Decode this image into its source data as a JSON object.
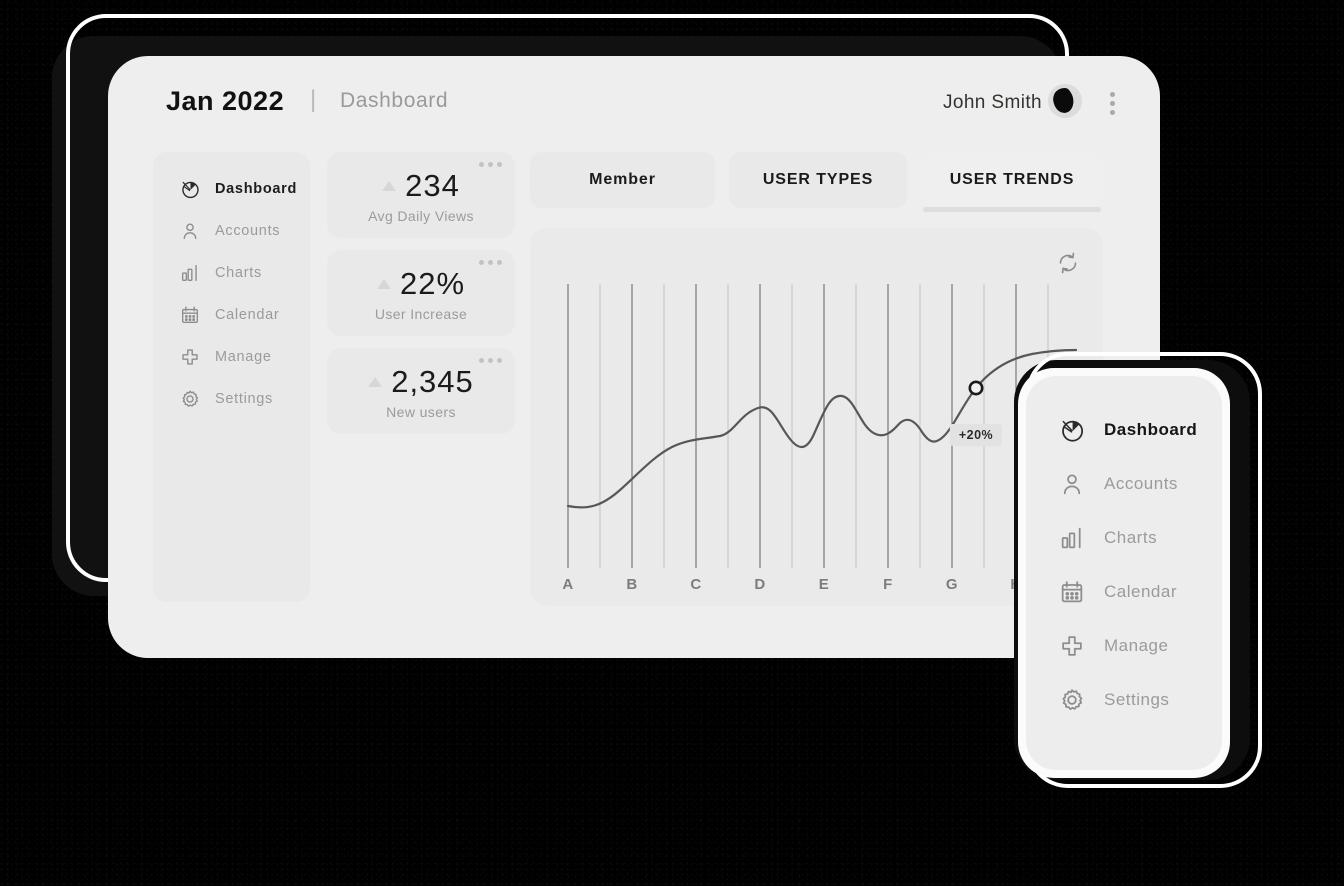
{
  "header": {
    "date_title": "Jan 2022",
    "separator": "|",
    "breadcrumb": "Dashboard",
    "user_name": "John Smith",
    "avatar_icon": "user-avatar",
    "menu_icon": "kebab-vertical-icon"
  },
  "sidebar": {
    "items": [
      {
        "label": "Dashboard",
        "icon": "pie-chart-icon",
        "active": true
      },
      {
        "label": "Accounts",
        "icon": "user-icon",
        "active": false
      },
      {
        "label": "Charts",
        "icon": "bar-chart-icon",
        "active": false
      },
      {
        "label": "Calendar",
        "icon": "calendar-icon",
        "active": false
      },
      {
        "label": "Manage",
        "icon": "plus-icon",
        "active": false
      },
      {
        "label": "Settings",
        "icon": "gear-icon",
        "active": false
      }
    ]
  },
  "stats": [
    {
      "value": "234",
      "label": "Avg Daily Views",
      "trend": "up",
      "menu": "more-icon"
    },
    {
      "value": "22%",
      "label": "User Increase",
      "trend": "up",
      "menu": "more-icon"
    },
    {
      "value": "2,345",
      "label": "New users",
      "trend": "up",
      "menu": "more-icon"
    }
  ],
  "tabs": [
    {
      "label": "Member",
      "active": false
    },
    {
      "label": "USER TYPES",
      "active": false
    },
    {
      "label": "USER TRENDS",
      "active": true
    }
  ],
  "chart_panel": {
    "refresh_icon": "refresh-icon",
    "annotation": "+20%"
  },
  "phone": {
    "items": [
      {
        "label": "Dashboard",
        "icon": "pie-chart-icon",
        "active": true
      },
      {
        "label": "Accounts",
        "icon": "user-icon",
        "active": false
      },
      {
        "label": "Charts",
        "icon": "bar-chart-icon",
        "active": false
      },
      {
        "label": "Calendar",
        "icon": "calendar-icon",
        "active": false
      },
      {
        "label": "Manage",
        "icon": "plus-icon",
        "active": false
      },
      {
        "label": "Settings",
        "icon": "gear-icon",
        "active": false
      }
    ]
  },
  "colors": {
    "background": "#000000",
    "panel": "#eeeeee",
    "card": "#e9e9e9",
    "text_primary": "#1b1b1b",
    "text_muted": "#9b9b9b",
    "line": "#555555"
  },
  "chart_data": {
    "type": "line",
    "title": "",
    "xlabel": "",
    "ylabel": "",
    "grid": true,
    "gridlines": 16,
    "categories": [
      "A",
      "B",
      "C",
      "D",
      "E",
      "F",
      "G",
      "H"
    ],
    "tick_labels": [
      "A",
      "B",
      "C",
      "D",
      "E",
      "F",
      "G",
      "H"
    ],
    "x": [
      0,
      0.5,
      1,
      1.5,
      2,
      2.5,
      3,
      3.5,
      4,
      4.5,
      5,
      5.5,
      6,
      6.5,
      7,
      7.5,
      8
    ],
    "values": [
      22,
      23,
      30,
      42,
      46,
      44,
      38,
      58,
      66,
      52,
      50,
      54,
      45,
      48,
      62,
      78,
      86
    ],
    "ylim": [
      0,
      100
    ],
    "annotations": [
      {
        "text": "+20%",
        "x": 7.0,
        "y": 40,
        "marker": true
      }
    ],
    "marker_point": {
      "x": 7.0,
      "y": 70
    },
    "legend": []
  }
}
